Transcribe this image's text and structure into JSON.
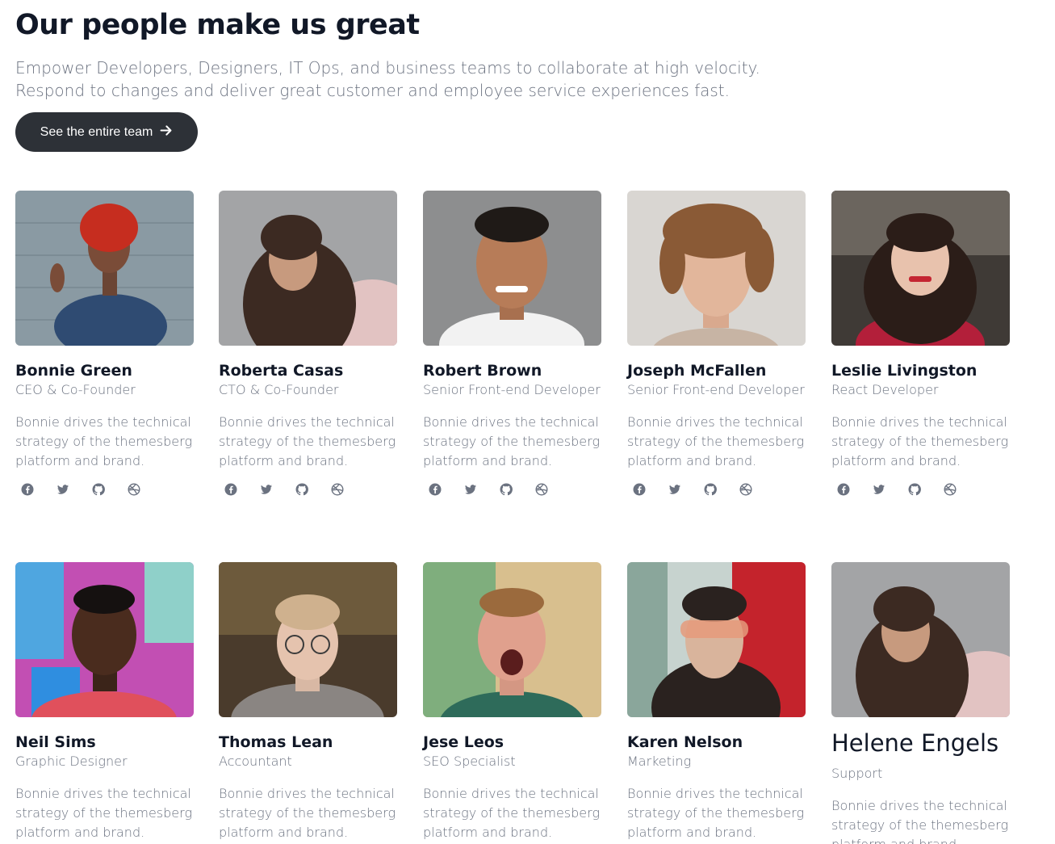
{
  "header": {
    "title": "Our people make us great",
    "subtitle": "Empower Developers, Designers, IT Ops, and business teams to collaborate at high velocity. Respond to changes and deliver great customer and employee service experiences fast.",
    "cta_label": "See the entire team"
  },
  "members": [
    {
      "name": "Bonnie Green",
      "role": "CEO & Co-Founder",
      "desc": "Bonnie drives the technical strategy of the themesberg platform and brand.",
      "social": [
        "facebook-icon",
        "twitter-icon",
        "github-icon",
        "dribbble-icon"
      ]
    },
    {
      "name": "Roberta Casas",
      "role": "CTO & Co-Founder",
      "desc": "Bonnie drives the technical strategy of the themesberg platform and brand.",
      "social": [
        "facebook-icon",
        "twitter-icon",
        "github-icon",
        "dribbble-icon"
      ]
    },
    {
      "name": "Robert Brown",
      "role": "Senior Front-end Developer",
      "desc": "Bonnie drives the technical strategy of the themesberg platform and brand.",
      "social": [
        "facebook-icon",
        "twitter-icon",
        "github-icon",
        "dribbble-icon"
      ]
    },
    {
      "name": "Joseph McFallen",
      "role": "Senior Front-end Developer",
      "desc": "Bonnie drives the technical strategy of the themesberg platform and brand.",
      "social": [
        "facebook-icon",
        "twitter-icon",
        "github-icon",
        "dribbble-icon"
      ]
    },
    {
      "name": "Leslie Livingston",
      "role": "React Developer",
      "desc": "Bonnie drives the technical strategy of the themesberg platform and brand.",
      "social": [
        "facebook-icon",
        "twitter-icon",
        "github-icon",
        "dribbble-icon"
      ]
    },
    {
      "name": "Neil Sims",
      "role": "Graphic Designer",
      "desc": "Bonnie drives the technical strategy of the themesberg platform and brand."
    },
    {
      "name": "Thomas Lean",
      "role": "Accountant",
      "desc": "Bonnie drives the technical strategy of the themesberg platform and brand."
    },
    {
      "name": "Jese Leos",
      "role": "SEO Specialist",
      "desc": "Bonnie drives the technical strategy of the themesberg platform and brand."
    },
    {
      "name": "Karen Nelson",
      "role": "Marketing",
      "desc": "Bonnie drives the technical strategy of the themesberg platform and brand."
    },
    {
      "name": "Helene Engels",
      "role": "Support",
      "desc": "Bonnie drives the technical strategy of the themesberg platform and brand."
    }
  ],
  "colors": {
    "button_bg": "#2d3137",
    "heading": "#111827",
    "muted_text": "#6b7280",
    "icon": "#6b7280"
  }
}
